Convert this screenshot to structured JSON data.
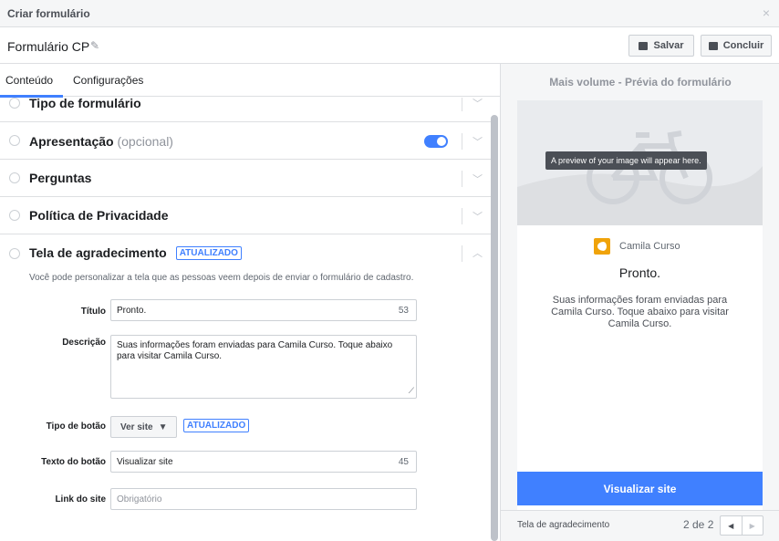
{
  "titlebar": {
    "title": "Criar formulário",
    "close": "×"
  },
  "header": {
    "form_name": "Formulário CP",
    "save_label": "Salvar",
    "done_label": "Concluir"
  },
  "tabs": {
    "content": "Conteúdo",
    "settings": "Configurações"
  },
  "sections": [
    {
      "title": "Tipo de formulário"
    },
    {
      "title": "Apresentação",
      "optional": "(opcional)",
      "toggle_on": true
    },
    {
      "title": "Perguntas"
    },
    {
      "title": "Política de Privacidade"
    },
    {
      "title": "Tela de agradecimento",
      "badge": "ATUALIZADO"
    }
  ],
  "thanks": {
    "description": "Você pode personalizar a tela que as pessoas veem depois de enviar o formulário de cadastro.",
    "title_label": "Título",
    "title_value": "Pronto.",
    "title_count": "53",
    "desc_label": "Descrição",
    "desc_value": "Suas informações foram enviadas para Camila Curso. Toque abaixo para visitar Camila Curso.",
    "button_type_label": "Tipo de botão",
    "button_type_value": "Ver site",
    "button_type_badge": "ATUALIZADO",
    "button_text_label": "Texto do botão",
    "button_text_value": "Visualizar site",
    "button_text_count": "45",
    "link_label": "Link do site",
    "link_placeholder": "Obrigatório"
  },
  "preview": {
    "panel_title": "Mais volume - Prévia do formulário",
    "image_tip": "A preview of your image will appear here.",
    "brand": "Camila Curso",
    "title": "Pronto.",
    "description": "Suas informações foram enviadas para Camila Curso. Toque abaixo para visitar Camila Curso.",
    "cta": "Visualizar site",
    "footer_label": "Tela de agradecimento",
    "page": "2 de 2"
  },
  "colors": {
    "accent": "#4080ff",
    "logo": "#f0a30a"
  }
}
